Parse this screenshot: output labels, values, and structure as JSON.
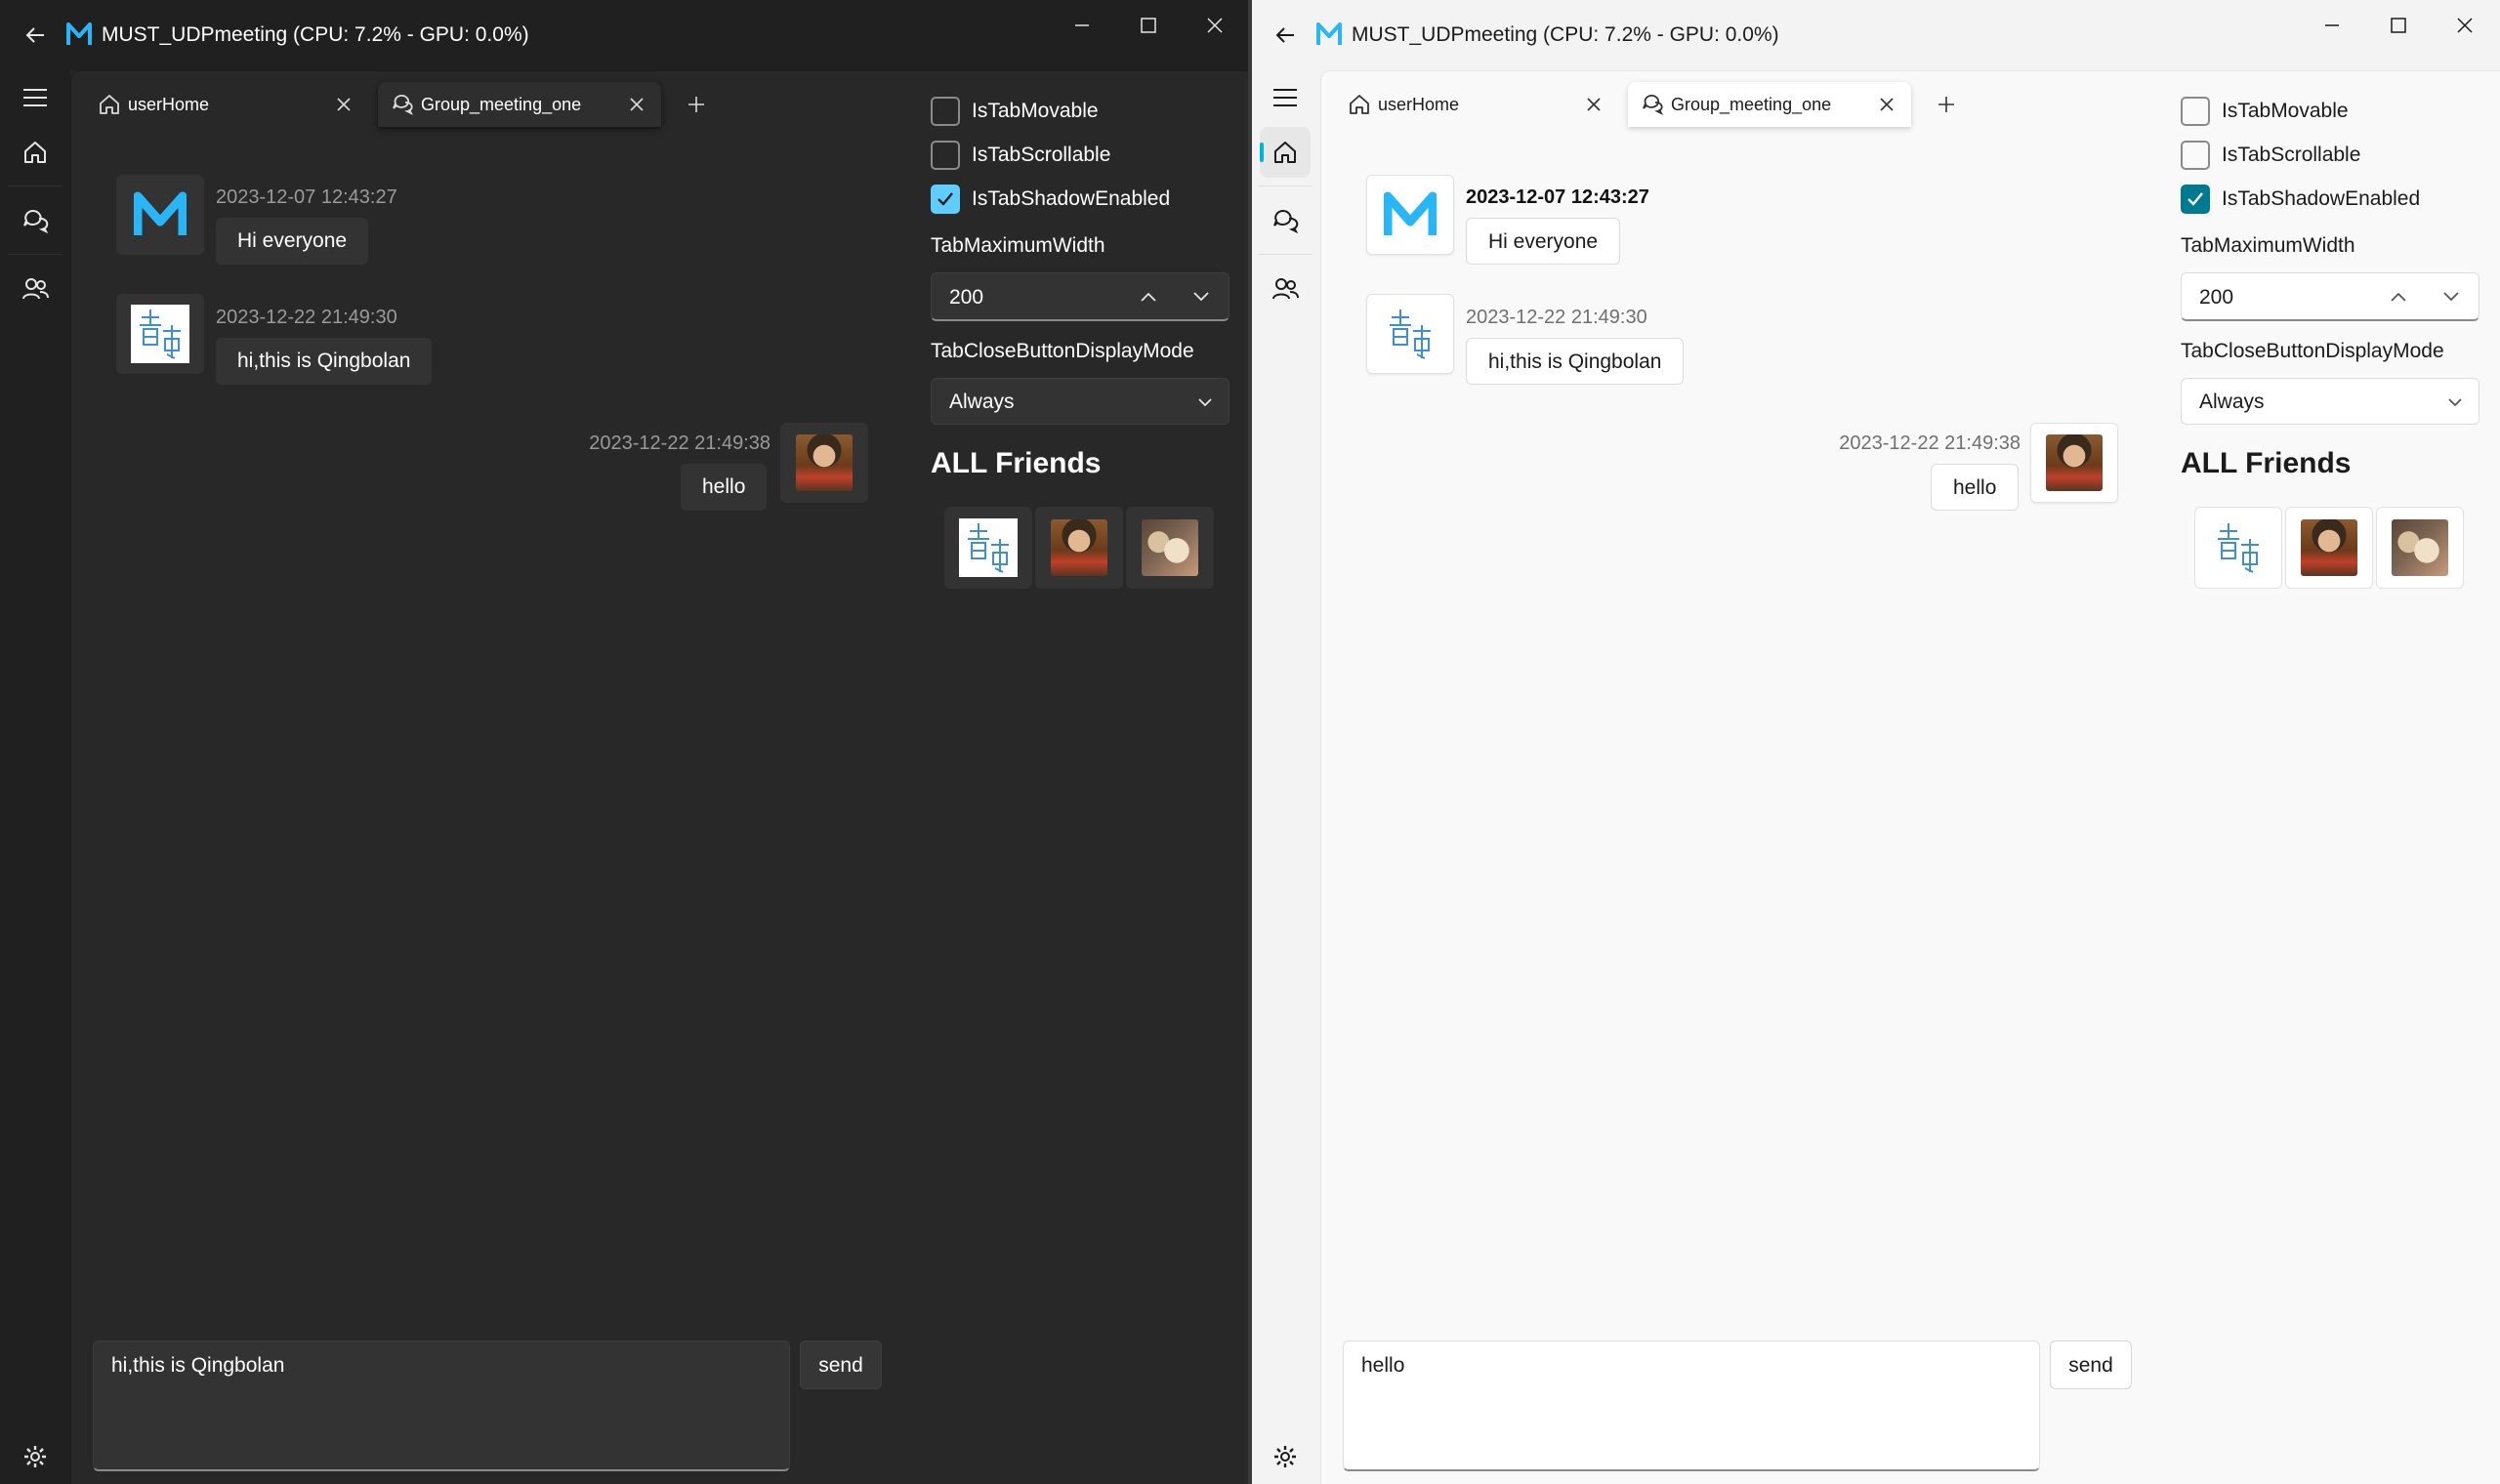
{
  "window": {
    "title": "MUST_UDPmeeting (CPU: 7.2% - GPU: 0.0%)"
  },
  "nav_items": [
    "menu-icon",
    "home-icon",
    "chat-icon",
    "friends-icon",
    "settings-icon"
  ],
  "tabs": [
    {
      "label": "userHome",
      "icon": "home-icon"
    },
    {
      "label": "Group_meeting_one",
      "icon": "chat-icon"
    }
  ],
  "messages": [
    {
      "timestamp": "2023-12-07 12:43:27",
      "text": "Hi everyone",
      "avatar": "m-logo",
      "side": "left"
    },
    {
      "timestamp": "2023-12-22 21:49:30",
      "text": "hi,this is Qingbolan",
      "avatar": "qing-calligraphy",
      "side": "left"
    },
    {
      "timestamp": "2023-12-22 21:49:38",
      "text": "hello",
      "avatar": "girl-photo",
      "side": "right"
    }
  ],
  "send_label": "send",
  "settings": {
    "checkboxes": [
      {
        "label": "IsTabMovable",
        "checked": false
      },
      {
        "label": "IsTabScrollable",
        "checked": false
      },
      {
        "label": "IsTabShadowEnabled",
        "checked": true
      }
    ],
    "max_width_label": "TabMaximumWidth",
    "max_width_value": "200",
    "close_mode_label": "TabCloseButtonDisplayMode",
    "close_mode_value": "Always"
  },
  "friends_heading": "ALL Friends",
  "dark": {
    "input_text": "hi,this is Qingbolan",
    "accent": "#60cdff",
    "background": "#272727"
  },
  "light": {
    "input_text": "hello",
    "accent": "#007a92",
    "background": "#f3f3f3"
  }
}
